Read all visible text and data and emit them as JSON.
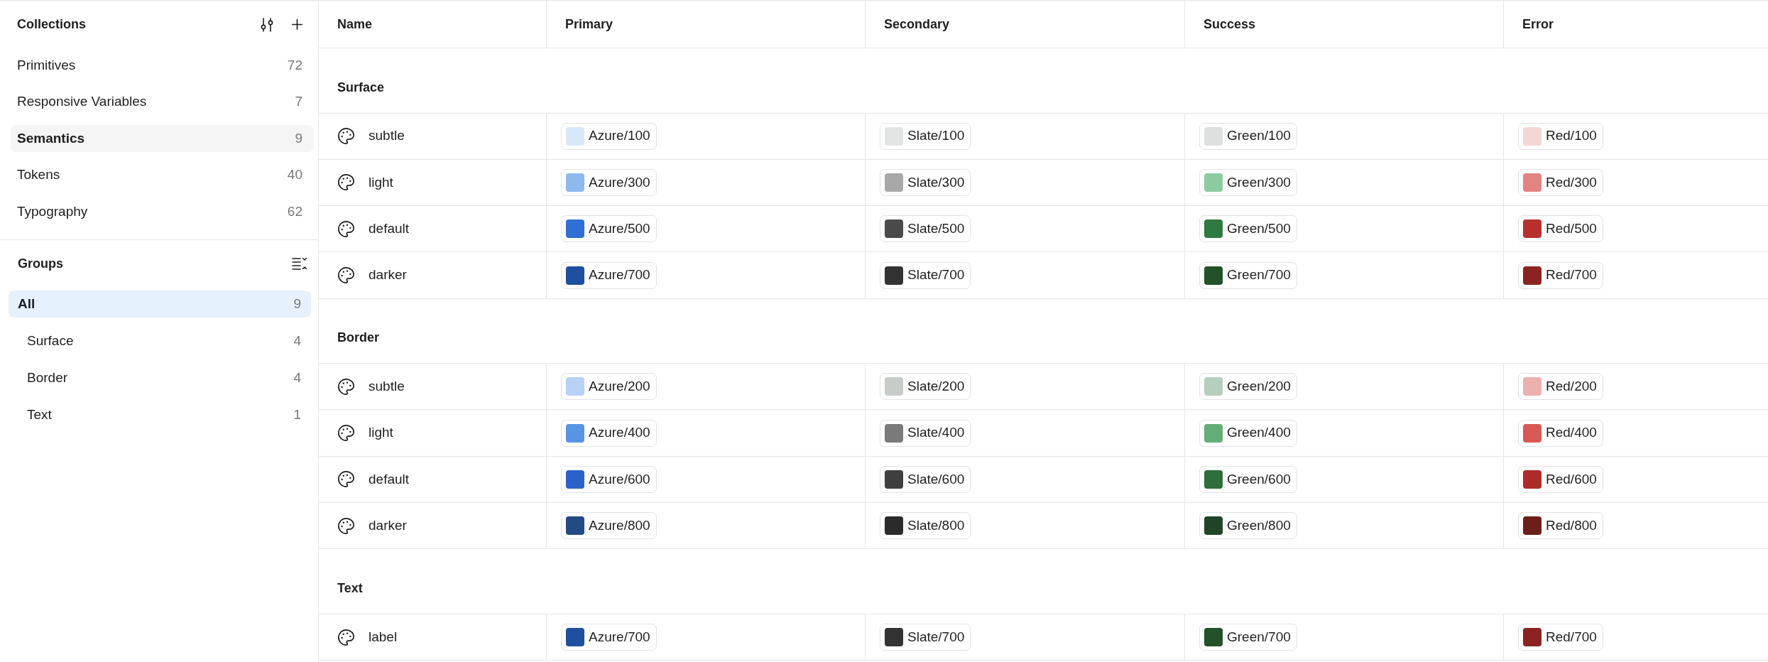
{
  "sidebar": {
    "collections": {
      "title": "Collections",
      "items": [
        {
          "label": "Primitives",
          "count": "72",
          "selected": false
        },
        {
          "label": "Responsive Variables",
          "count": "7",
          "selected": false
        },
        {
          "label": "Semantics",
          "count": "9",
          "selected": true
        },
        {
          "label": "Tokens",
          "count": "40",
          "selected": false
        },
        {
          "label": "Typography",
          "count": "62",
          "selected": false
        }
      ]
    },
    "groups": {
      "title": "Groups",
      "items": [
        {
          "label": "All",
          "count": "9",
          "selected": true,
          "children": [
            {
              "label": "Surface",
              "count": "4",
              "selected": false
            },
            {
              "label": "Border",
              "count": "4",
              "selected": false
            },
            {
              "label": "Text",
              "count": "1",
              "selected": false
            }
          ]
        }
      ]
    }
  },
  "table": {
    "columns": [
      "Name",
      "Primary",
      "Secondary",
      "Success",
      "Error"
    ],
    "groups": [
      {
        "title": "Surface",
        "rows": [
          {
            "name": "subtle",
            "values": [
              {
                "label": "Azure/100",
                "color": "#d9e8f8"
              },
              {
                "label": "Slate/100",
                "color": "#e3e4e4"
              },
              {
                "label": "Green/100",
                "color": "#dde0de"
              },
              {
                "label": "Red/100",
                "color": "#f4d6d4"
              }
            ]
          },
          {
            "name": "light",
            "values": [
              {
                "label": "Azure/300",
                "color": "#8fb8ee"
              },
              {
                "label": "Slate/300",
                "color": "#a8a8a8"
              },
              {
                "label": "Green/300",
                "color": "#8ccba0"
              },
              {
                "label": "Red/300",
                "color": "#e38480"
              }
            ]
          },
          {
            "name": "default",
            "values": [
              {
                "label": "Azure/500",
                "color": "#2f6fd6"
              },
              {
                "label": "Slate/500",
                "color": "#4a4a4a"
              },
              {
                "label": "Green/500",
                "color": "#2f7a40"
              },
              {
                "label": "Red/500",
                "color": "#b8302e"
              }
            ]
          },
          {
            "name": "darker",
            "values": [
              {
                "label": "Azure/700",
                "color": "#1f4f9e"
              },
              {
                "label": "Slate/700",
                "color": "#333333"
              },
              {
                "label": "Green/700",
                "color": "#22522a"
              },
              {
                "label": "Red/700",
                "color": "#8b2420"
              }
            ]
          }
        ]
      },
      {
        "title": "Border",
        "rows": [
          {
            "name": "subtle",
            "values": [
              {
                "label": "Azure/200",
                "color": "#b7d1f5"
              },
              {
                "label": "Slate/200",
                "color": "#c8ccc9"
              },
              {
                "label": "Green/200",
                "color": "#b6cfbd"
              },
              {
                "label": "Red/200",
                "color": "#ecb0ae"
              }
            ]
          },
          {
            "name": "light",
            "values": [
              {
                "label": "Azure/400",
                "color": "#5795e3"
              },
              {
                "label": "Slate/400",
                "color": "#7a7a7a"
              },
              {
                "label": "Green/400",
                "color": "#63ae76"
              },
              {
                "label": "Red/400",
                "color": "#d95a55"
              }
            ]
          },
          {
            "name": "default",
            "values": [
              {
                "label": "Azure/600",
                "color": "#2a62c9"
              },
              {
                "label": "Slate/600",
                "color": "#3f3f3f"
              },
              {
                "label": "Green/600",
                "color": "#2e6e3a"
              },
              {
                "label": "Red/600",
                "color": "#ad2c2a"
              }
            ]
          },
          {
            "name": "darker",
            "values": [
              {
                "label": "Azure/800",
                "color": "#244a85"
              },
              {
                "label": "Slate/800",
                "color": "#2b2b2b"
              },
              {
                "label": "Green/800",
                "color": "#1f4526"
              },
              {
                "label": "Red/800",
                "color": "#6e1e1a"
              }
            ]
          }
        ]
      },
      {
        "title": "Text",
        "rows": [
          {
            "name": "label",
            "values": [
              {
                "label": "Azure/700",
                "color": "#1f4f9e"
              },
              {
                "label": "Slate/700",
                "color": "#333333"
              },
              {
                "label": "Green/700",
                "color": "#22522a"
              },
              {
                "label": "Red/700",
                "color": "#8b2420"
              }
            ]
          }
        ]
      }
    ]
  }
}
